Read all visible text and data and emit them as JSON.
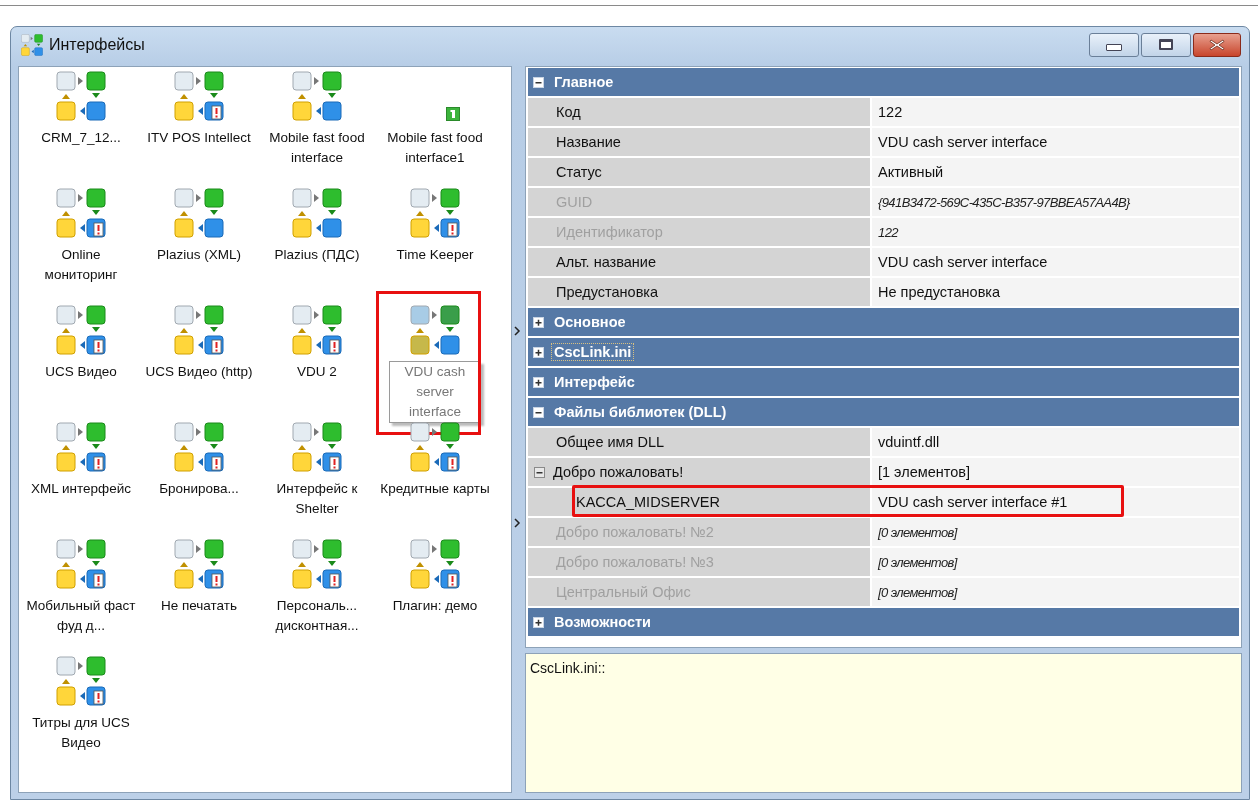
{
  "window": {
    "title": "Интерфейсы"
  },
  "items": [
    {
      "label": "CRM_7_12...",
      "kind": "plain",
      "selected": false,
      "annotated": false
    },
    {
      "label": "ITV POS Intellect",
      "kind": "alert",
      "selected": false,
      "annotated": false
    },
    {
      "label": "Mobile fast food interface",
      "kind": "plain",
      "selected": false,
      "annotated": false
    },
    {
      "label": "Mobile fast food interface1",
      "kind": "number",
      "selected": false,
      "annotated": false
    },
    {
      "label": "Online мониторинг",
      "kind": "alert",
      "selected": false,
      "annotated": false
    },
    {
      "label": "Plazius (XML)",
      "kind": "plain",
      "selected": false,
      "annotated": false
    },
    {
      "label": "Plazius (ПДС)",
      "kind": "plain",
      "selected": false,
      "annotated": false
    },
    {
      "label": "Time Keeper",
      "kind": "alert",
      "selected": false,
      "annotated": false
    },
    {
      "label": "UCS Видео",
      "kind": "alert",
      "selected": false,
      "annotated": false
    },
    {
      "label": "UCS Видео (http)",
      "kind": "alert",
      "selected": false,
      "annotated": false
    },
    {
      "label": "VDU 2",
      "kind": "alert",
      "selected": false,
      "annotated": false
    },
    {
      "label": "VDU cash server interface",
      "kind": "plain",
      "selected": true,
      "annotated": true
    },
    {
      "label": "XML интерфейс",
      "kind": "alert",
      "selected": false,
      "annotated": false
    },
    {
      "label": "Бронирова...",
      "kind": "alert",
      "selected": false,
      "annotated": false
    },
    {
      "label": "Интерфейс к Shelter",
      "kind": "alert",
      "selected": false,
      "annotated": false
    },
    {
      "label": "Кредитные карты",
      "kind": "alert",
      "selected": false,
      "annotated": false
    },
    {
      "label": "Мобильный фаст фуд д...",
      "kind": "alert",
      "selected": false,
      "annotated": false
    },
    {
      "label": "Не печатать",
      "kind": "alert",
      "selected": false,
      "annotated": false
    },
    {
      "label": "Персональ... дисконтная...",
      "kind": "alert",
      "selected": false,
      "annotated": false
    },
    {
      "label": "Плагин: демо",
      "kind": "alert",
      "selected": false,
      "annotated": false
    },
    {
      "label": "Титры для UCS Видео",
      "kind": "alert",
      "selected": false,
      "annotated": false
    }
  ],
  "properties": {
    "sections": [
      {
        "title": "Главное",
        "expanded": true,
        "focused": false,
        "rows": [
          {
            "name": "Код",
            "value": "122",
            "disabled": false,
            "annotated": false
          },
          {
            "name": "Название",
            "value": "VDU cash server interface",
            "disabled": false,
            "annotated": false
          },
          {
            "name": "Статус",
            "value": "Активный",
            "disabled": false,
            "annotated": false
          },
          {
            "name": "GUID",
            "value": "{941B3472-569C-435C-B357-97BBEA57AA4B}",
            "disabled": true,
            "annotated": false
          },
          {
            "name": "Идентификатор",
            "value": "122",
            "disabled": true,
            "annotated": false
          },
          {
            "name": "Альт. название",
            "value": "VDU cash server interface",
            "disabled": false,
            "annotated": false
          },
          {
            "name": "Предустановка",
            "value": "Не предустановка",
            "disabled": false,
            "annotated": false
          }
        ]
      },
      {
        "title": "Основное",
        "expanded": false,
        "focused": false
      },
      {
        "title": "CscLink.ini",
        "expanded": false,
        "focused": true
      },
      {
        "title": "Интерфейс",
        "expanded": false,
        "focused": false
      },
      {
        "title": "Файлы библиотек (DLL)",
        "expanded": true,
        "focused": false,
        "rows": [
          {
            "name": "Общее имя DLL",
            "value": "vduintf.dll",
            "disabled": false,
            "annotated": false
          },
          {
            "name": "Добро пожаловать!",
            "value": "[1 элементов]",
            "disabled": false,
            "annotated": false,
            "expanded": true,
            "children": [
              {
                "name": "KACCA_MIDSERVER",
                "value": "VDU cash server interface #1",
                "disabled": false,
                "annotated": true
              }
            ]
          },
          {
            "name": "Добро пожаловать! №2",
            "value": "[0 элементов]",
            "disabled": true,
            "annotated": false
          },
          {
            "name": "Добро пожаловать! №3",
            "value": "[0 элементов]",
            "disabled": true,
            "annotated": false
          },
          {
            "name": "Центральный Офис",
            "value": "[0 элементов]",
            "disabled": true,
            "annotated": false
          }
        ]
      },
      {
        "title": "Возможности",
        "expanded": false,
        "focused": false
      }
    ]
  },
  "description": {
    "text": "CscLink.ini::"
  }
}
